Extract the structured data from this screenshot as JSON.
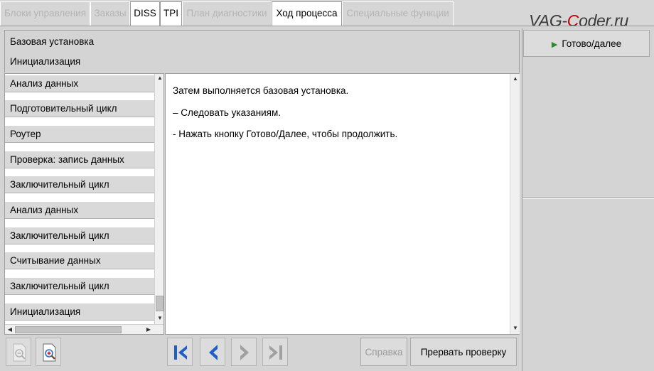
{
  "tabs": [
    {
      "label": "Блоки управления",
      "active": false
    },
    {
      "label": "Заказы",
      "active": false
    },
    {
      "label": "DISS",
      "active": true
    },
    {
      "label": "TPI",
      "active": true
    },
    {
      "label": "План диагностики",
      "active": false
    },
    {
      "label": "Ход процесса",
      "active": true
    },
    {
      "label": "Специальные функции",
      "active": false
    }
  ],
  "brand": {
    "part1": "VAG-",
    "part2": "C",
    "part3": "oder.ru"
  },
  "header": {
    "line1": "Базовая установка",
    "line2": "Инициализация"
  },
  "steps": [
    "Анализ данных",
    "Подготовительный цикл",
    "Роутер",
    "Проверка: запись данных",
    "Заключительный цикл",
    "Анализ данных",
    "Заключительный цикл",
    "Считывание данных",
    "Заключительный цикл",
    "Инициализация"
  ],
  "content": {
    "lines": [
      "Затем выполняется базовая установка.",
      "– Следовать указаниям.",
      "- Нажать кнопку Готово/Далее, чтобы продолжить."
    ]
  },
  "right_panel": {
    "done_label": "Готово/далее"
  },
  "toolbar": {
    "help_label": "Справка",
    "abort_label": "Прервать проверку"
  },
  "colors": {
    "nav_arrow": "#1f5fc6",
    "nav_arrow_disabled": "#a0a0a0",
    "play": "#2e8b2e",
    "brand_accent": "#c40000"
  }
}
